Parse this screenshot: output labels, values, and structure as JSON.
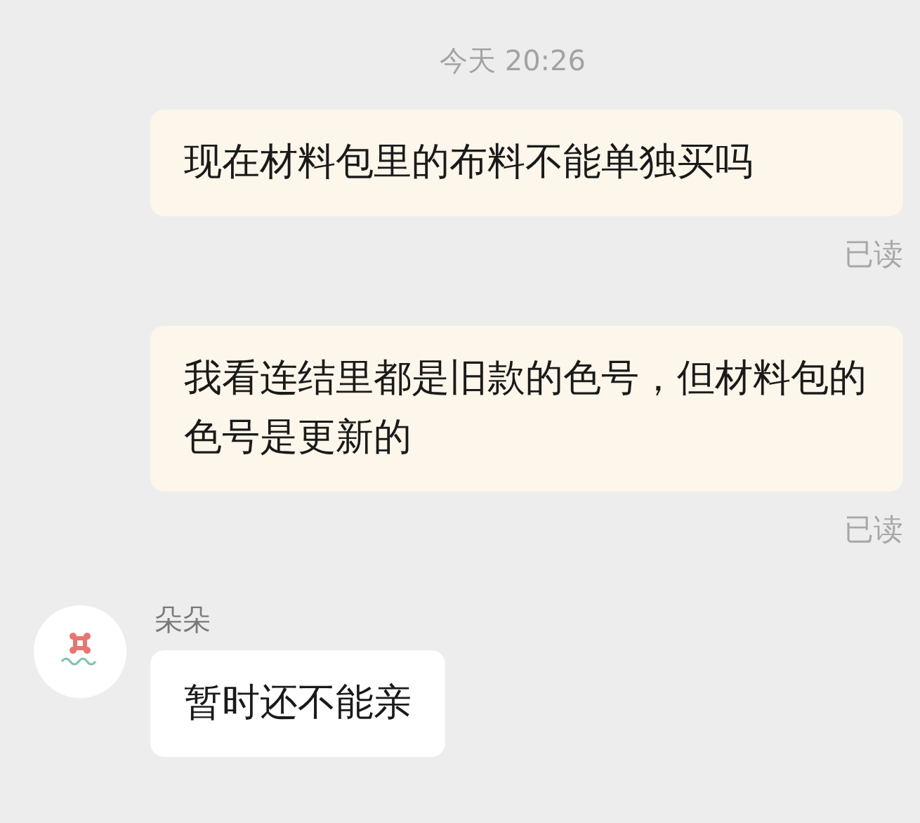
{
  "timestamp": "今天 20:26",
  "messages": [
    {
      "kind": "outgoing",
      "text": "现在材料包里的布料不能单独买吗",
      "receipt": "已读"
    },
    {
      "kind": "outgoing",
      "text": "我看连结里都是旧款的色号，但材料包的色号是更新的",
      "receipt": "已读"
    },
    {
      "kind": "incoming",
      "sender": "朵朵",
      "text": "暂时还不能亲"
    }
  ]
}
